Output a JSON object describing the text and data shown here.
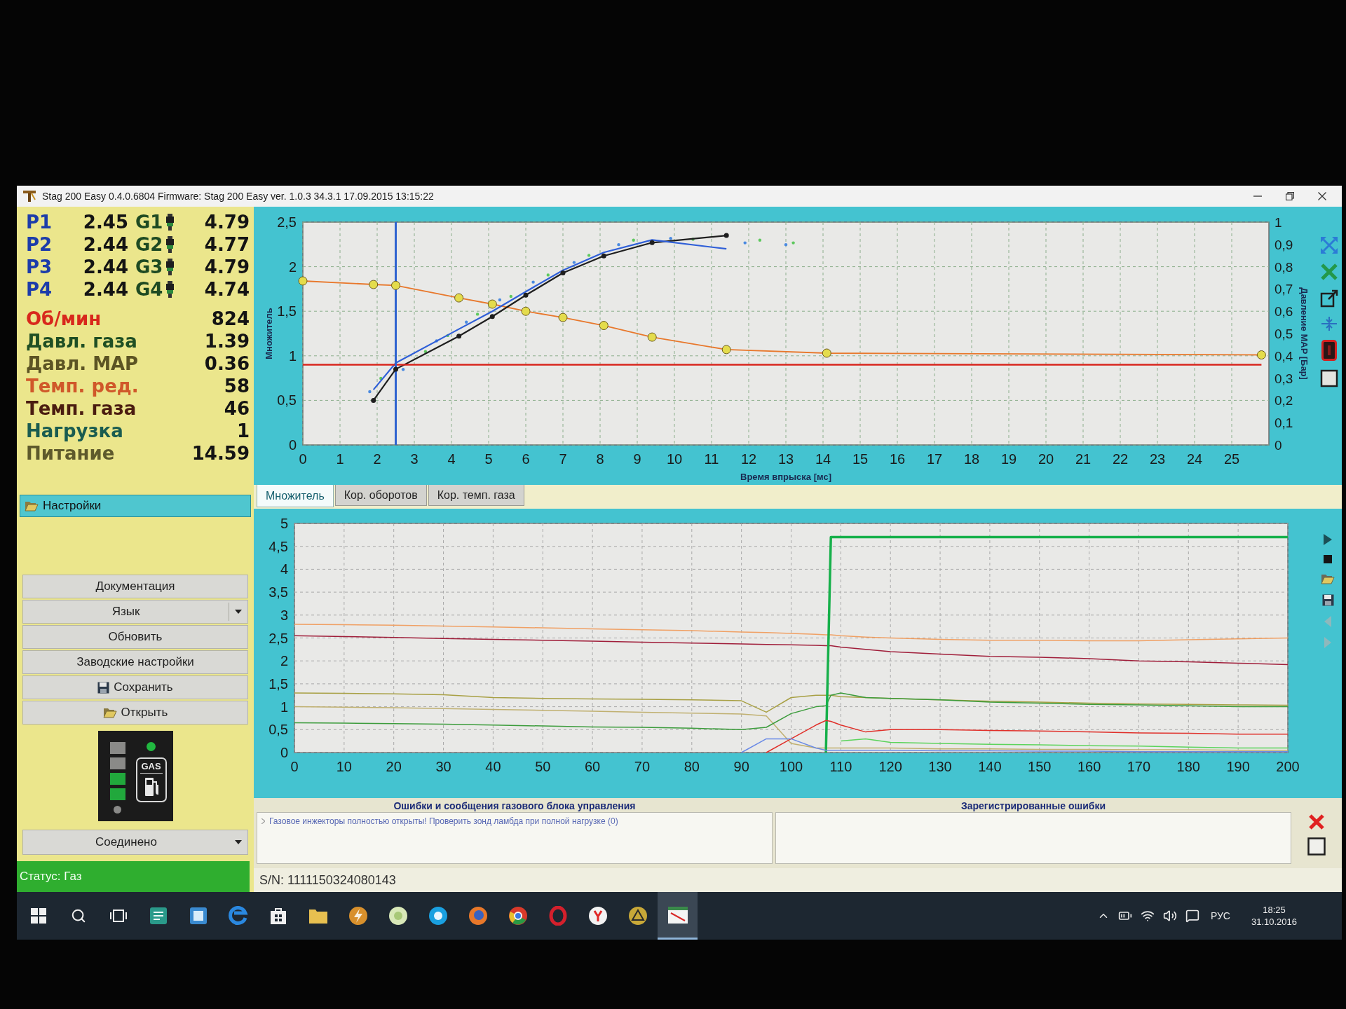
{
  "window": {
    "title": "Stag 200 Easy 0.4.0.6804 Firmware: Stag 200 Easy ver. 1.0.3 34.3.1 17.09.2015 13:15:22"
  },
  "readings": {
    "injectors": [
      {
        "p_label": "P1",
        "p_value": "2.45",
        "g_label": "G1",
        "g_value": "4.79"
      },
      {
        "p_label": "P2",
        "p_value": "2.44",
        "g_label": "G2",
        "g_value": "4.77"
      },
      {
        "p_label": "P3",
        "p_value": "2.44",
        "g_label": "G3",
        "g_value": "4.79"
      },
      {
        "p_label": "P4",
        "p_value": "2.44",
        "g_label": "G4",
        "g_value": "4.74"
      }
    ],
    "parameters": [
      {
        "label": "Об/мин",
        "value": "824",
        "color": "#d8281c"
      },
      {
        "label": "Давл. газа",
        "value": "1.39",
        "color": "#1f4f24"
      },
      {
        "label": "Давл. MAP",
        "value": "0.36",
        "color": "#5c5424"
      },
      {
        "label": "Темп. ред.",
        "value": "58",
        "color": "#d0582a"
      },
      {
        "label": "Темп. газа",
        "value": "46",
        "color": "#4a1c10"
      },
      {
        "label": "Нагрузка",
        "value": "1",
        "color": "#1a5c50"
      },
      {
        "label": "Питание",
        "value": "14.59",
        "color": "#5e5a2c"
      }
    ]
  },
  "settings": {
    "label": "Настройки"
  },
  "sidebar_buttons": [
    {
      "label": "Документация",
      "kind": "plain"
    },
    {
      "label": "Язык",
      "kind": "dropdown"
    },
    {
      "label": "Обновить",
      "kind": "plain"
    },
    {
      "label": "Заводские настройки",
      "kind": "plain"
    },
    {
      "label": "Сохранить",
      "kind": "save"
    },
    {
      "label": "Открыть",
      "kind": "open"
    }
  ],
  "gas_indicator": {
    "label": "GAS",
    "leds": [
      {
        "on": false
      },
      {
        "on": false
      },
      {
        "on": true
      },
      {
        "on": true
      }
    ],
    "reserve_on": false,
    "gas_on": true
  },
  "connection": {
    "value": "Соединено"
  },
  "status": "Статус: Газ",
  "main_chart": {
    "chart_data": {
      "type": "line",
      "xlabel": "Время впрыска [мс]",
      "ylabel": "Множитель",
      "y2label": "Давление MAP [Бар]",
      "grid": true,
      "x": [
        0,
        1.9,
        2.5,
        4.2,
        5.1,
        6,
        7,
        8.1,
        9.4,
        11.4,
        14.1,
        25.8
      ],
      "series": [
        {
          "color": "#e8782c",
          "marker": "circle",
          "values": [
            1.84,
            1.8,
            1.79,
            1.65,
            1.58,
            1.5,
            1.43,
            1.34,
            1.21,
            1.07,
            1.03,
            1.01
          ]
        },
        {
          "color": "#1e1e1e",
          "marker": "circle",
          "values": [
            null,
            0.5,
            0.85,
            1.22,
            1.44,
            1.68,
            1.93,
            2.12,
            2.27,
            2.35,
            null,
            null
          ]
        },
        {
          "color": "#2f5fd8",
          "values": [
            null,
            0.62,
            0.92,
            1.3,
            1.5,
            1.72,
            1.96,
            2.16,
            2.3,
            2.2,
            null,
            null
          ]
        },
        {
          "color": "#d8261e",
          "axis": "y2",
          "values": [
            0.36,
            0.36,
            0.36,
            0.36,
            0.36,
            0.36,
            0.36,
            0.36,
            0.36,
            0.36,
            0.36,
            0.36
          ]
        }
      ],
      "xlim": [
        0,
        26
      ],
      "ylim": [
        0,
        2.5
      ],
      "y2lim": [
        0,
        1
      ],
      "xticks": [
        0,
        1,
        2,
        3,
        4,
        5,
        6,
        7,
        8,
        9,
        10,
        11,
        12,
        13,
        14,
        15,
        16,
        17,
        18,
        19,
        20,
        21,
        22,
        23,
        24,
        25
      ],
      "yticks": [
        0,
        {
          "value": 0.5,
          "label": "0,5"
        },
        1,
        {
          "value": 1.5,
          "label": "1,5"
        },
        2,
        {
          "value": 2.5,
          "label": "2,5"
        }
      ],
      "y2ticks": [
        0,
        {
          "value": 0.1,
          "label": "0,1"
        },
        {
          "value": 0.2,
          "label": "0,2"
        },
        {
          "value": 0.3,
          "label": "0,3"
        },
        {
          "value": 0.4,
          "label": "0,4"
        },
        {
          "value": 0.5,
          "label": "0,5"
        },
        {
          "value": 0.6,
          "label": "0,6"
        },
        {
          "value": 0.7,
          "label": "0,7"
        },
        {
          "value": 0.8,
          "label": "0,8"
        },
        {
          "value": 0.9,
          "label": "0,9"
        },
        1
      ],
      "ref_lines": [
        {
          "axis": "x",
          "value": 2.5
        }
      ]
    }
  },
  "tabs": [
    {
      "label": "Множитель",
      "selected": true
    },
    {
      "label": "Кор. оборотов",
      "selected": false
    },
    {
      "label": "Кор. темп. газа",
      "selected": false
    }
  ],
  "log_chart": {
    "chart_data": {
      "type": "line",
      "grid": true,
      "x": [
        0,
        10,
        20,
        30,
        40,
        50,
        60,
        70,
        80,
        90,
        95,
        100,
        105,
        107,
        108,
        110,
        115,
        120,
        130,
        140,
        150,
        160,
        170,
        180,
        190,
        200
      ],
      "series": [
        {
          "color": "#f0a064",
          "values": [
            2.8,
            2.79,
            2.78,
            2.76,
            2.74,
            2.72,
            2.7,
            2.68,
            2.66,
            2.63,
            2.62,
            2.6,
            2.58,
            2.57,
            2.57,
            2.55,
            2.52,
            2.5,
            2.47,
            2.45,
            2.45,
            2.44,
            2.44,
            2.46,
            2.48,
            2.5
          ]
        },
        {
          "color": "#a01e3a",
          "values": [
            2.55,
            2.53,
            2.51,
            2.49,
            2.47,
            2.45,
            2.43,
            2.41,
            2.39,
            2.37,
            2.36,
            2.35,
            2.34,
            2.33,
            2.33,
            2.3,
            2.25,
            2.2,
            2.15,
            2.1,
            2.08,
            2.05,
            2.0,
            1.98,
            1.95,
            1.92
          ]
        },
        {
          "color": "#a8a044",
          "values": [
            1.3,
            1.29,
            1.28,
            1.26,
            1.2,
            1.18,
            1.17,
            1.16,
            1.15,
            1.13,
            0.88,
            1.2,
            1.25,
            1.25,
            1.25,
            1.22,
            1.2,
            1.18,
            1.15,
            1.12,
            1.1,
            1.08,
            1.06,
            1.05,
            1.04,
            1.03
          ]
        },
        {
          "color": "#c0b070",
          "values": [
            1.0,
            0.99,
            0.98,
            0.96,
            0.94,
            0.92,
            0.9,
            0.88,
            0.86,
            0.84,
            0.8,
            0.2,
            0.1,
            0.1,
            0.1,
            0.1,
            0.1,
            0.1,
            0.08,
            0.08,
            0.07,
            0.07,
            0.06,
            0.06,
            0.05,
            0.05
          ]
        },
        {
          "color": "#3c9c3c",
          "values": [
            0.65,
            0.64,
            0.63,
            0.62,
            0.6,
            0.58,
            0.56,
            0.55,
            0.53,
            0.5,
            0.55,
            0.85,
            1.0,
            1.02,
            1.25,
            1.3,
            1.2,
            1.18,
            1.15,
            1.1,
            1.08,
            1.05,
            1.04,
            1.02,
            1.0,
            1.0
          ]
        },
        {
          "color": "#16b04a",
          "values": [
            null,
            null,
            null,
            null,
            null,
            null,
            null,
            null,
            null,
            null,
            null,
            null,
            null,
            0,
            4.7,
            4.7,
            4.7,
            4.7,
            4.7,
            4.7,
            4.7,
            4.7,
            4.7,
            4.7,
            4.7,
            4.7
          ]
        },
        {
          "color": "#e0302a",
          "values": [
            null,
            null,
            null,
            null,
            null,
            null,
            null,
            null,
            null,
            null,
            0,
            0.3,
            0.6,
            0.7,
            0.68,
            0.6,
            0.45,
            0.5,
            0.5,
            0.48,
            0.47,
            0.45,
            0.43,
            0.42,
            0.4,
            0.4
          ]
        },
        {
          "color": "#5cd45c",
          "values": [
            null,
            null,
            null,
            null,
            null,
            null,
            null,
            null,
            null,
            null,
            null,
            null,
            null,
            null,
            null,
            0.25,
            0.3,
            0.22,
            0.2,
            0.18,
            0.17,
            0.15,
            0.14,
            0.12,
            0.1,
            0.1
          ]
        },
        {
          "color": "#6a8ae6",
          "values": [
            null,
            null,
            null,
            null,
            null,
            null,
            null,
            null,
            null,
            0,
            0.3,
            0.3,
            0.1,
            0.05,
            0.05,
            0.05,
            0.05,
            0.05,
            0.04,
            0.04,
            0.03,
            0.03,
            0.02,
            0.02,
            0.02,
            0.02
          ]
        }
      ],
      "xlim": [
        0,
        200
      ],
      "ylim": [
        0,
        5
      ],
      "xticks": [
        0,
        10,
        20,
        30,
        40,
        50,
        60,
        70,
        80,
        90,
        100,
        110,
        120,
        130,
        140,
        150,
        160,
        170,
        180,
        190,
        200
      ],
      "yticks": [
        0,
        {
          "value": 0.5,
          "label": "0,5"
        },
        1,
        {
          "value": 1.5,
          "label": "1,5"
        },
        2,
        {
          "value": 2.5,
          "label": "2,5"
        },
        3,
        {
          "value": 3.5,
          "label": "3,5"
        },
        4,
        {
          "value": 4.5,
          "label": "4,5"
        },
        5
      ]
    },
    "toolbar": [
      {
        "disabled": false
      },
      {
        "disabled": false
      },
      {
        "disabled": false
      },
      {
        "disabled": false
      },
      {
        "disabled": true
      },
      {
        "disabled": true
      }
    ]
  },
  "messages": {
    "title": "Ошибки и сообщения газового блока управления",
    "items": [
      {
        "text": "Газовое инжекторы полностью открыты! Проверить зонд ламбда при полной нагрузке (0)"
      }
    ]
  },
  "registered_errors": {
    "title": "Зарегистрированные ошибки"
  },
  "serial_number": "S/N: 1111150324080143",
  "taskbar": {
    "apps": [
      {
        "selected": false
      },
      {
        "selected": false
      },
      {
        "selected": false
      },
      {
        "selected": false
      },
      {
        "selected": false
      },
      {
        "selected": false
      },
      {
        "selected": false
      },
      {
        "selected": false
      },
      {
        "selected": false
      },
      {
        "selected": false
      },
      {
        "selected": false
      },
      {
        "selected": false
      },
      {
        "selected": false
      },
      {
        "selected": true
      }
    ],
    "language": "РУС",
    "time": "18:25",
    "date": "31.10.2016"
  }
}
